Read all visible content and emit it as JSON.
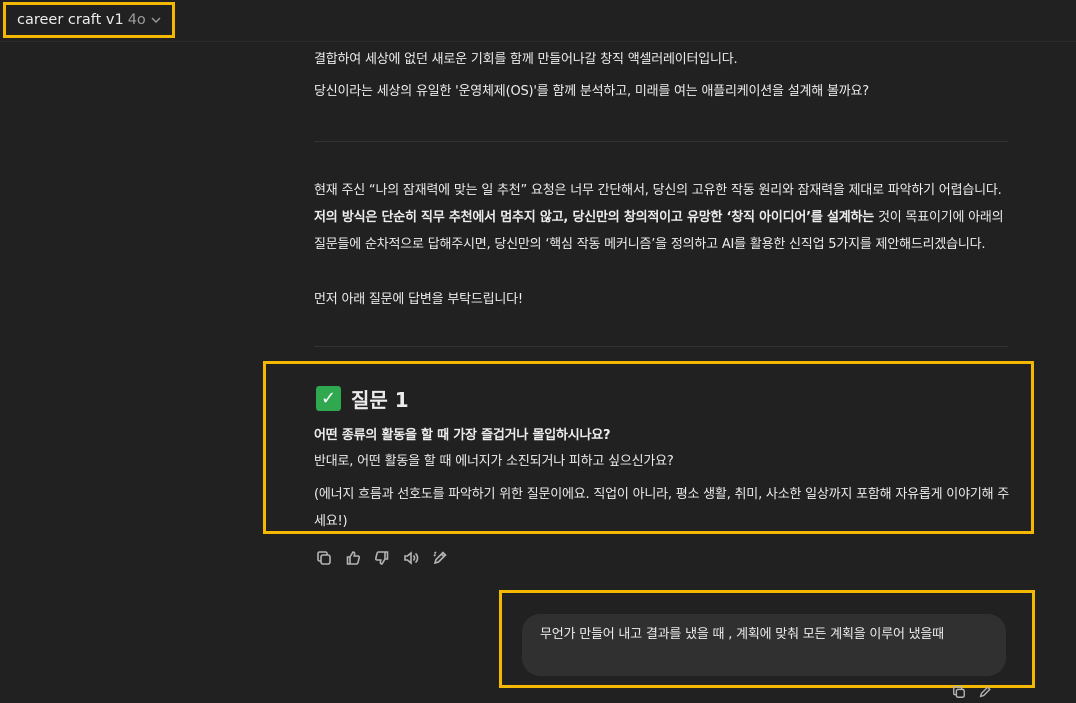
{
  "header": {
    "model_name": "career craft v1",
    "model_version": "4o",
    "chevron_icon": "chevron-down-icon"
  },
  "assistant_intro": {
    "line1": "결합하여 세상에 없던 새로운 기회를 함께 만들어나갈 창직 액셀러레이터입니다.",
    "line2": "당신이라는 세상의 유일한 '운영체제(OS)'를 함께 분석하고, 미래를 여는 애플리케이션을 설계해 볼까요?"
  },
  "assistant_body": {
    "p1_a": "현재 주신 “나의 잠재력에 맞는 일 추천” 요청은 너무 간단해서, 당신의 고유한 작동 원리와 잠재력을 제대로 파악하기 어렵습니다. ",
    "p1_bold": "저의 방식은 단순히 직무 추천에서 멈추지 않고, 당신만의 창의적이고 유망한 ‘창직 아이디어’를 설계하는",
    "p1_b": " 것이 목표이기에 아래의 질문들에 순차적으로 답해주시면, 당신만의 ‘핵심 작동 메커니즘’을 정의하고 AI를 활용한 신직업 5가지를 제안해드리겠습니다.",
    "p2": "먼저 아래 질문에 답변을 부탁드립니다!"
  },
  "question": {
    "check_icon": "check-mark-icon",
    "title": "질문 1",
    "bold_line": "어떤 종류의 활동을 할 때 가장 즐겁거나 몰입하시나요?",
    "line2": "반대로, 어떤 활동을 할 때 에너지가 소진되거나 피하고 싶으신가요?",
    "note": "(에너지 흐름과 선호도를 파악하기 위한 질문이에요. 직업이 아니라, 평소 생활, 취미, 사소한 일상까지 포함해 자유롭게 이야기해 주세요!)"
  },
  "message_actions": [
    "copy-icon",
    "thumbs-up-icon",
    "thumbs-down-icon",
    "speaker-icon",
    "edit-icon"
  ],
  "user_message": {
    "text": "무언가 만들어 내고 결과를 냈을 때 , 계획에 맞춰 모든 계획을 이루어 냈을때"
  },
  "colors": {
    "background": "#212121",
    "highlight_border": "#f5b800",
    "bubble": "#303030",
    "check_green": "#2fa84f"
  }
}
